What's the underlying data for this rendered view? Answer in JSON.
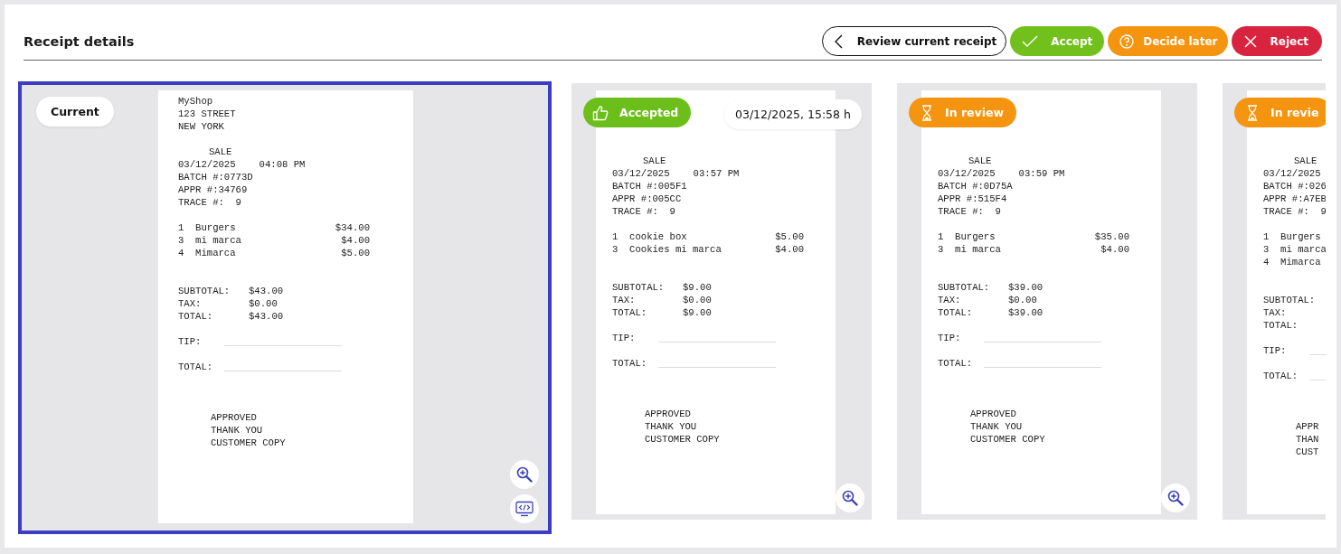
{
  "header": {
    "title": "Receipt details",
    "buttons": [
      {
        "kind": "review",
        "label": "Review current receipt"
      },
      {
        "kind": "accept",
        "label": "Accept"
      },
      {
        "kind": "decide_later",
        "label": "Decide later"
      },
      {
        "kind": "reject",
        "label": "Reject"
      }
    ]
  },
  "receipts": [
    {
      "selected": true,
      "status": {
        "kind": "current",
        "label": "Current"
      },
      "zoom_button": true,
      "code_button": true,
      "paper": {
        "header": [
          "MyShop",
          "123 STREET",
          "NEW YORK"
        ],
        "sale": "SALE",
        "date": "03/12/2025",
        "time": "04:08 PM",
        "batch": "BATCH #:0773D",
        "appr": "APPR #:34769",
        "trace": "TRACE #:  9",
        "items": [
          {
            "name": "1  Burgers",
            "price": "$34.00"
          },
          {
            "name": "3  mi marca",
            "price": "$4.00"
          },
          {
            "name": "4  Mimarca",
            "price": "$5.00"
          }
        ],
        "totals": [
          {
            "label": "SUBTOTAL:",
            "value": "$43.00"
          },
          {
            "label": "TAX:",
            "value": "$0.00"
          },
          {
            "label": "TOTAL:",
            "value": "$43.00"
          }
        ],
        "sign_lines": [
          "TIP:",
          "TOTAL:"
        ],
        "footer": [
          "APPROVED",
          "THANK YOU",
          "CUSTOMER COPY"
        ]
      }
    },
    {
      "selected": false,
      "status": {
        "kind": "accepted",
        "label": "Accepted"
      },
      "timestamp": "03/12/2025, 15:58 h",
      "zoom_button": true,
      "paper": {
        "sale": "SALE",
        "date": "03/12/2025",
        "time": "03:57 PM",
        "batch": "BATCH #:005F1",
        "appr": "APPR #:005CC",
        "trace": "TRACE #:  9",
        "items": [
          {
            "name": "1  cookie box",
            "price": "$5.00"
          },
          {
            "name": "3  Cookies mi marca",
            "price": "$4.00"
          }
        ],
        "totals": [
          {
            "label": "SUBTOTAL:",
            "value": "$9.00"
          },
          {
            "label": "TAX:",
            "value": "$0.00"
          },
          {
            "label": "TOTAL:",
            "value": "$9.00"
          }
        ],
        "sign_lines": [
          "TIP:",
          "TOTAL:"
        ],
        "footer": [
          "APPROVED",
          "THANK YOU",
          "CUSTOMER COPY"
        ]
      }
    },
    {
      "selected": false,
      "status": {
        "kind": "in_review",
        "label": "In review"
      },
      "zoom_button": true,
      "paper": {
        "sale": "SALE",
        "date": "03/12/2025",
        "time": "03:59 PM",
        "batch": "BATCH #:0D75A",
        "appr": "APPR #:515F4",
        "trace": "TRACE #:  9",
        "items": [
          {
            "name": "1  Burgers",
            "price": "$35.00"
          },
          {
            "name": "3  mi marca",
            "price": "$4.00"
          }
        ],
        "totals": [
          {
            "label": "SUBTOTAL:",
            "value": "$39.00"
          },
          {
            "label": "TAX:",
            "value": "$0.00"
          },
          {
            "label": "TOTAL:",
            "value": "$39.00"
          }
        ],
        "sign_lines": [
          "TIP:",
          "TOTAL:"
        ],
        "footer": [
          "APPROVED",
          "THANK YOU",
          "CUSTOMER COPY"
        ]
      }
    },
    {
      "selected": false,
      "status": {
        "kind": "in_review",
        "label": "In revie"
      },
      "paper": {
        "sale": "SALE",
        "date": "03/12/2025",
        "batch": "BATCH #:026",
        "appr": "APPR #:A7EB",
        "trace": "TRACE #:  9",
        "items": [
          {
            "name": "1  Burgers"
          },
          {
            "name": "3  mi marca"
          },
          {
            "name": "4  Mimarca"
          }
        ],
        "totals": [
          {
            "label": "SUBTOTAL:"
          },
          {
            "label": "TAX:"
          },
          {
            "label": "TOTAL:"
          }
        ],
        "sign_lines": [
          "TIP:",
          "TOTAL:"
        ],
        "footer": [
          "APPR",
          "THAN",
          "CUST"
        ]
      }
    }
  ]
}
